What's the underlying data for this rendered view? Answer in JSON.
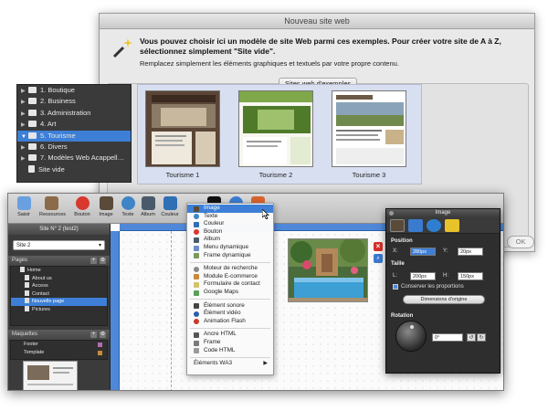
{
  "dialog": {
    "title": "Nouveau site web",
    "headline": "Vous pouvez choisir ici un modèle de site Web parmi ces exemples. Pour créer votre site de A à Z, sélectionnez simplement \"Site vide\".",
    "subline": "Remplacez simplement les éléments graphiques et textuels par votre propre contenu.",
    "group_label": "Sites web d'exemples",
    "ok_label": "OK",
    "categories": [
      "1. Boutique",
      "2. Business",
      "3. Administration",
      "4. Art",
      "5. Tourisme",
      "6. Divers",
      "7. Modèles Web Acappell…",
      "Site vide"
    ],
    "selected_category": "5. Tourisme",
    "previews": [
      "Tourisme 1",
      "Tourisme 2",
      "Tourisme 3"
    ]
  },
  "toolbar": {
    "items": [
      "Saisir",
      "Ressources",
      "Bouton",
      "Image",
      "Texte",
      "Album",
      "Couleur"
    ]
  },
  "sidebar": {
    "site_title": "Site N° 2 (test2)",
    "site_select": "Site 2",
    "pages_label": "Pages",
    "pages": [
      "Home",
      "About us",
      "Access",
      "Contact",
      "Nouvelle page",
      "Pictures"
    ],
    "selected_page": "Nouvelle page",
    "masters_label": "Maquettes",
    "masters": [
      "Footer",
      "Template"
    ]
  },
  "menu": {
    "items": [
      "Image",
      "Texte",
      "Couleur",
      "Bouton",
      "Album",
      "Menu dynamique",
      "Frame dynamique",
      "Moteur de recherche",
      "Module E-commerce",
      "Formulaire de contact",
      "Google Maps",
      "Élément sonore",
      "Élément vidéo",
      "Animation Flash",
      "Ancre HTML",
      "Frame",
      "Code HTML",
      "Éléments WA3"
    ],
    "selected": "Image"
  },
  "inspector": {
    "title": "Image",
    "position_label": "Position",
    "x_label": "X:",
    "x_value": "280px",
    "y_label": "Y:",
    "y_value": "20px",
    "size_label": "Taille",
    "l_label": "L:",
    "l_value": "200px",
    "h_label": "H:",
    "h_value": "150px",
    "keep_ratio_label": "Conserver les proportions",
    "original_size_label": "Dimensions d'origine",
    "rotation_label": "Rotation",
    "rotation_value": "0°"
  },
  "colors": {
    "selection": "#3d7fd6",
    "ruler": "#4f88d8",
    "panel_dark": "#3b3b3b"
  }
}
